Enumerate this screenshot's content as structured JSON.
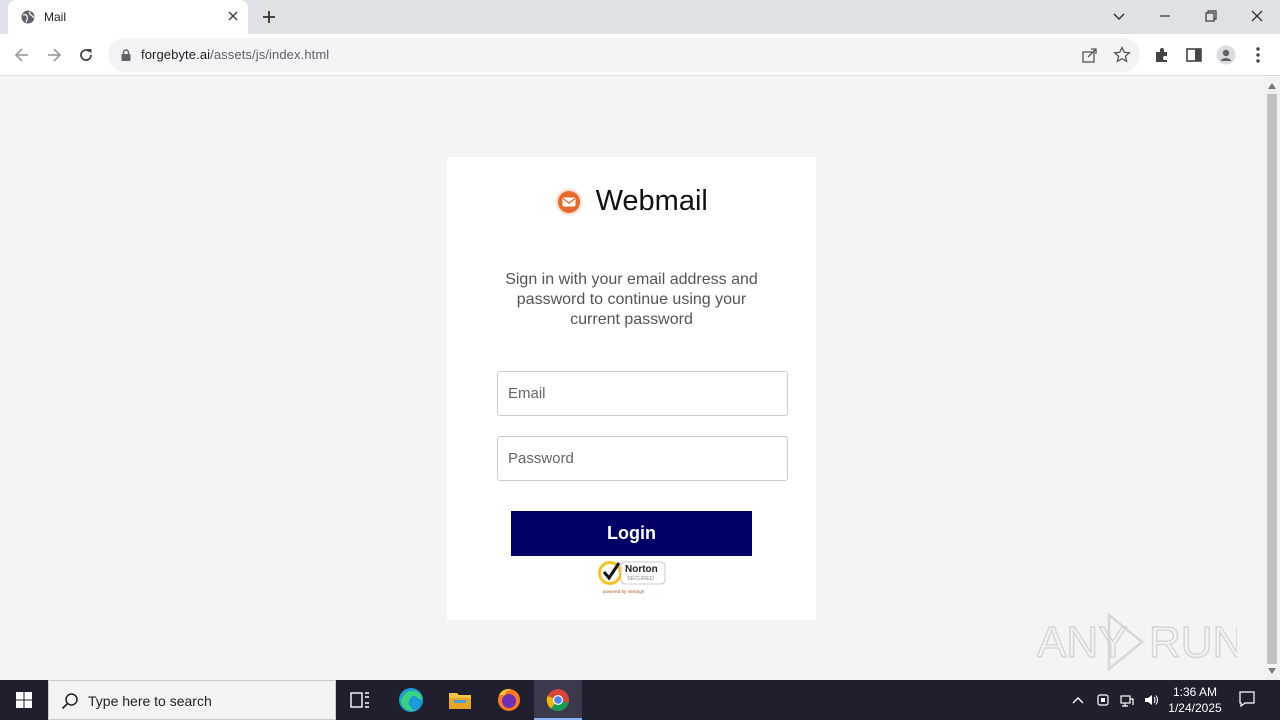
{
  "browser": {
    "tab_title": "Mail",
    "url_domain": "forgebyte.ai",
    "url_path": "/assets/js/index.html"
  },
  "page": {
    "brand_title": "Webmail",
    "subtitle": "Sign in with your email address and password to continue using your current password",
    "email_placeholder": "Email",
    "password_placeholder": "Password",
    "login_label": "Login",
    "badge_label": "Norton",
    "badge_sub": "SECURED",
    "badge_powered": "powered by VeriSign"
  },
  "watermark": "ANY RUN",
  "taskbar": {
    "search_placeholder": "Type here to search",
    "time": "1:36 AM",
    "date": "1/24/2025"
  },
  "colors": {
    "login_button": "#000066",
    "brand_icon": "#e8692c"
  }
}
